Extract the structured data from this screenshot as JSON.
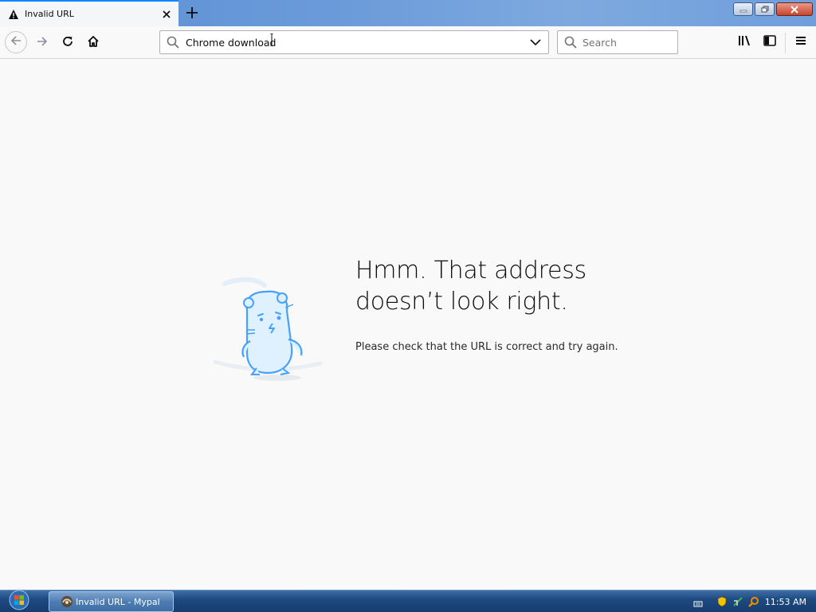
{
  "tab": {
    "title": "Invalid URL",
    "icon": "warning-icon"
  },
  "window_controls": {
    "minimize_icon": "minimize-icon",
    "restore_icon": "restore-icon",
    "close_icon": "close-icon"
  },
  "navbar": {
    "url_text": "Chrome download",
    "search_placeholder": "Search"
  },
  "error": {
    "title_line1": "Hmm. That address",
    "title_line2": "doesn’t look right.",
    "description": "Please check that the URL is correct and try again."
  },
  "taskbar": {
    "task_label": "Invalid URL - Mypal",
    "time": "11:53 AM"
  },
  "colors": {
    "accent": "#0a84ff",
    "illustration": "#45a1ff",
    "taskbar": "#1e4a82"
  }
}
